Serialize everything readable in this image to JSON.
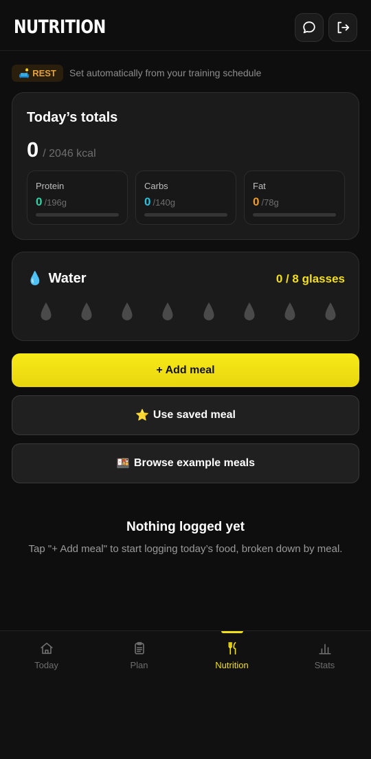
{
  "header": {
    "title": "NUTRITION",
    "chat_icon": "chat-bubble-icon",
    "logout_icon": "logout-icon"
  },
  "day_type": {
    "icon": "sofa-emoji",
    "badge": "REST",
    "description": "Set automatically from your training schedule"
  },
  "totals": {
    "title": "Today’s totals",
    "kcal_value": "0",
    "kcal_goal": "/ 2046 kcal",
    "macros": [
      {
        "label": "Protein",
        "current": "0",
        "goal": "/196g",
        "color": "#2fd3a5",
        "fraction": 0
      },
      {
        "label": "Carbs",
        "current": "0",
        "goal": "/140g",
        "color": "#29c3e0",
        "fraction": 0
      },
      {
        "label": "Fat",
        "current": "0",
        "goal": "/78g",
        "color": "#ee9b2c",
        "fraction": 0
      }
    ]
  },
  "water": {
    "icon": "💧",
    "title": "Water",
    "count": "0 / 8 glasses",
    "glasses_filled": 0,
    "glasses_total": 8
  },
  "actions": {
    "add_meal": "+ Add meal",
    "saved_icon": "⭐",
    "saved_meal": "Use saved meal",
    "browse_icon": "🍱",
    "browse_meals": "Browse example meals"
  },
  "empty_state": {
    "title": "Nothing logged yet",
    "description": "Tap \"+ Add meal\" to start logging today’s food, broken down by meal."
  },
  "nav": {
    "items": [
      {
        "label": "Today",
        "icon": "home-icon"
      },
      {
        "label": "Plan",
        "icon": "clipboard-icon"
      },
      {
        "label": "Nutrition",
        "icon": "fork-knife-icon",
        "active": true
      },
      {
        "label": "Stats",
        "icon": "bar-chart-icon"
      }
    ]
  },
  "colors": {
    "accent": "#f3df1a",
    "background": "#0e0e0e",
    "card": "#1b1b1b"
  }
}
